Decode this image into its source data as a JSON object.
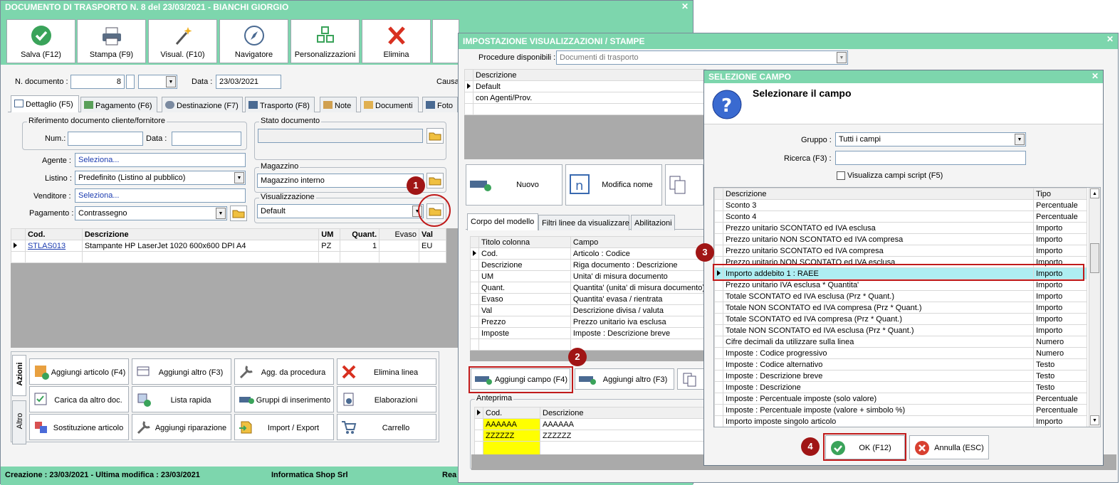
{
  "main": {
    "title": "DOCUMENTO DI TRASPORTO N. 8 del 23/03/2021 - BIANCHI GIORGIO",
    "toolbar": {
      "save": "Salva (F12)",
      "print": "Stampa (F9)",
      "visual": "Visual. (F10)",
      "navigator": "Navigatore",
      "custom": "Personalizzazioni",
      "delete": "Elimina"
    },
    "doc_number_label": "N. documento :",
    "doc_number": "8",
    "date_label": "Data :",
    "date": "23/03/2021",
    "causal_label": "Causa",
    "tabs": [
      "Dettaglio (F5)",
      "Pagamento (F6)",
      "Destinazione (F7)",
      "Trasporto (F8)",
      "Note",
      "Documenti",
      "Foto"
    ],
    "ref_group": "Riferimento documento cliente/fornitore",
    "num_label": "Num.:",
    "data_label": "Data :",
    "stato_group": "Stato documento",
    "agent_label": "Agente :",
    "agent_value": "Seleziona...",
    "listino_label": "Listino :",
    "listino_value": "Predefinito (Listino al pubblico)",
    "venditore_label": "Venditore :",
    "venditore_value": "Seleziona...",
    "pagamento_label": "Pagamento :",
    "pagamento_value": "Contrassegno",
    "magazzino_group": "Magazzino",
    "magazzino_value": "Magazzino interno",
    "visual_group": "Visualizzazione",
    "visual_value": "Default",
    "grid": {
      "headers": [
        "Cod.",
        "Descrizione",
        "UM",
        "Quant.",
        "Evaso",
        "Val"
      ],
      "rows": [
        [
          "STLAS013",
          "Stampante HP LaserJet 1020 600x600 DPI A4",
          "PZ",
          "1",
          "",
          "EU"
        ]
      ]
    },
    "side_tabs": [
      "Azioni",
      "Altro"
    ],
    "actions": [
      "Aggiungi articolo (F4)",
      "Aggiungi altro (F3)",
      "Agg. da procedura",
      "Elimina linea",
      "Carica da altro doc.",
      "Lista rapida",
      "Gruppi di inserimento",
      "Elaborazioni",
      "Sostituzione articolo",
      "Aggiungi riparazione",
      "Import / Export",
      "Carrello"
    ],
    "status": {
      "dates": "Creazione : 23/03/2021 - Ultima modifica : 23/03/2021",
      "company": "Informatica Shop Srl",
      "extra": "Rea"
    }
  },
  "settings": {
    "title": "IMPOSTAZIONE VISUALIZZAZIONI / STAMPE",
    "proc_label": "Procedure disponibili :",
    "proc_value": "Documenti di trasporto",
    "list_header": "Descrizione",
    "list": [
      "Default",
      "con Agenti/Prov."
    ],
    "new_btn": "Nuovo",
    "rename_btn": "Modifica nome",
    "tabs": [
      "Corpo del modello",
      "Filtri linee da visualizzare",
      "Abilitazioni"
    ],
    "col_headers": [
      "Titolo colonna",
      "Campo"
    ],
    "cols": [
      [
        "Cod.",
        "Articolo : Codice"
      ],
      [
        "Descrizione",
        "Riga documento : Descrizione"
      ],
      [
        "UM",
        "Unita' di misura documento"
      ],
      [
        "Quant.",
        "Quantita' (unita' di misura documento)"
      ],
      [
        "Evaso",
        "Quantita' evasa / rientrata"
      ],
      [
        "Val",
        "Descrizione divisa / valuta"
      ],
      [
        "Prezzo",
        "Prezzo unitario iva esclusa"
      ],
      [
        "Imposte",
        "Imposte : Descrizione breve"
      ]
    ],
    "add_field": "Aggiungi campo (F4)",
    "add_other": "Aggiungi altro (F3)",
    "preview_label": "Anteprima",
    "preview_headers": [
      "Cod.",
      "Descrizione"
    ],
    "preview_rows": [
      [
        "AAAAAA",
        "AAAAAA"
      ],
      [
        "ZZZZZZ",
        "ZZZZZZ"
      ]
    ]
  },
  "select": {
    "title": "SELEZIONE CAMPO",
    "heading": "Selezionare il campo",
    "group_label": "Gruppo :",
    "group_value": "Tutti i campi",
    "search_label": "Ricerca (F3) :",
    "search_value": "",
    "script_label": "Visualizza campi script (F5)",
    "headers": [
      "Descrizione",
      "Tipo"
    ],
    "rows": [
      [
        "Sconto 3",
        "Percentuale"
      ],
      [
        "Sconto 4",
        "Percentuale"
      ],
      [
        "Prezzo unitario SCONTATO ed IVA esclusa",
        "Importo"
      ],
      [
        "Prezzo unitario NON SCONTATO ed IVA compresa",
        "Importo"
      ],
      [
        "Prezzo unitario SCONTATO ed IVA compresa",
        "Importo"
      ],
      [
        "Prezzo unitario NON SCONTATO ed IVA esclusa",
        "Importo"
      ],
      [
        "Importo addebito 1 : RAEE",
        "Importo"
      ],
      [
        "Prezzo unitario IVA esclusa * Quantita'",
        "Importo"
      ],
      [
        "Totale SCONTATO ed IVA esclusa (Prz * Quant.)",
        "Importo"
      ],
      [
        "Totale NON SCONTATO ed IVA compresa (Prz * Quant.)",
        "Importo"
      ],
      [
        "Totale SCONTATO ed IVA compresa (Prz * Quant.)",
        "Importo"
      ],
      [
        "Totale NON SCONTATO ed IVA esclusa (Prz * Quant.)",
        "Importo"
      ],
      [
        "Cifre decimali da utilizzare sulla linea",
        "Numero"
      ],
      [
        "Imposte : Codice progressivo",
        "Numero"
      ],
      [
        "Imposte : Codice alternativo",
        "Testo"
      ],
      [
        "Imposte : Descrizione breve",
        "Testo"
      ],
      [
        "Imposte : Descrizione",
        "Testo"
      ],
      [
        "Imposte : Percentuale imposte (solo valore)",
        "Percentuale"
      ],
      [
        "Imposte : Percentuale imposte (valore + simbolo %)",
        "Percentuale"
      ],
      [
        "Importo imposte singolo articolo",
        "Importo"
      ]
    ],
    "selected_index": 6,
    "ok": "OK (F12)",
    "cancel": "Annulla (ESC)"
  },
  "markers": [
    "1",
    "2",
    "3",
    "4"
  ],
  "colors": {
    "title_bg": "#7dd6ad",
    "accent_red": "#c01a1a",
    "selected_row": "#aeeef2",
    "preview_yellow": "#ffff00"
  }
}
